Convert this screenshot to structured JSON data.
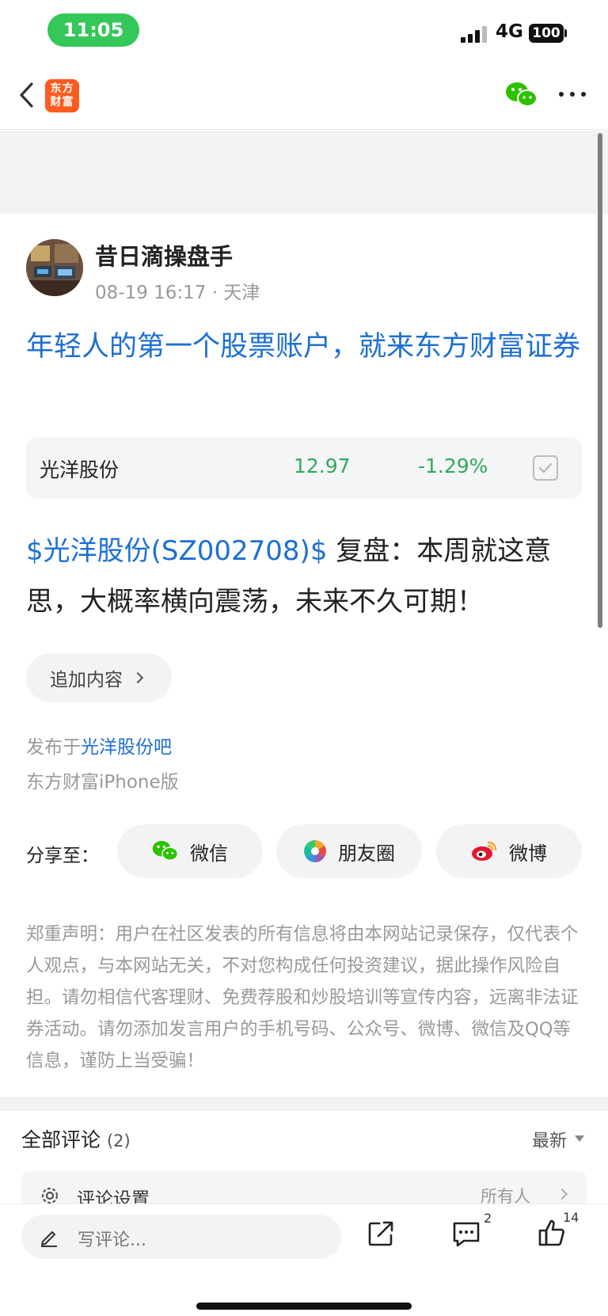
{
  "status_bar": {
    "time": "11:05",
    "network": "4G",
    "battery": "100"
  },
  "nav": {
    "logo_line1": "东方",
    "logo_line2": "财富"
  },
  "author": {
    "name": "昔日滴操盘手",
    "meta": "08-19 16:17 · 天津"
  },
  "post": {
    "title": "年轻人的第一个股票账户，就来东方财富证券",
    "stock_card": {
      "name": "光洋股份",
      "price": "12.97",
      "change": "-1.29%"
    },
    "body_stock_link": "$光洋股份(SZ002708)$",
    "body_text": "  复盘：本周就这意思，大概率横向震荡，未来不久可期！",
    "append_label": "追加内容",
    "published_prefix": "发布于",
    "published_bar": "光洋股份吧",
    "client": "东方财富iPhone版"
  },
  "share": {
    "label": "分享至：",
    "wechat": "微信",
    "moments": "朋友圈",
    "weibo": "微博"
  },
  "disclaimer": "郑重声明：用户在社区发表的所有信息将由本网站记录保存，仅代表个人观点，与本网站无关，不对您构成任何投资建议，据此操作风险自担。请勿相信代客理财、免费荐股和炒股培训等宣传内容，远离非法证券活动。请勿添加发言用户的手机号码、公众号、微博、微信及QQ等信息，谨防上当受骗！",
  "comments": {
    "title": "全部评论",
    "count": "(2)",
    "sort": "最新",
    "settings_label": "评论设置",
    "settings_value": "所有人"
  },
  "bottom_bar": {
    "input_placeholder": "写评论...",
    "comment_count": "2",
    "like_count": "14"
  },
  "colors": {
    "accent_blue": "#1d6fd4",
    "stock_green": "#2eab58",
    "time_pill_green": "#34c759",
    "brand_orange": "#ff5a1f"
  }
}
